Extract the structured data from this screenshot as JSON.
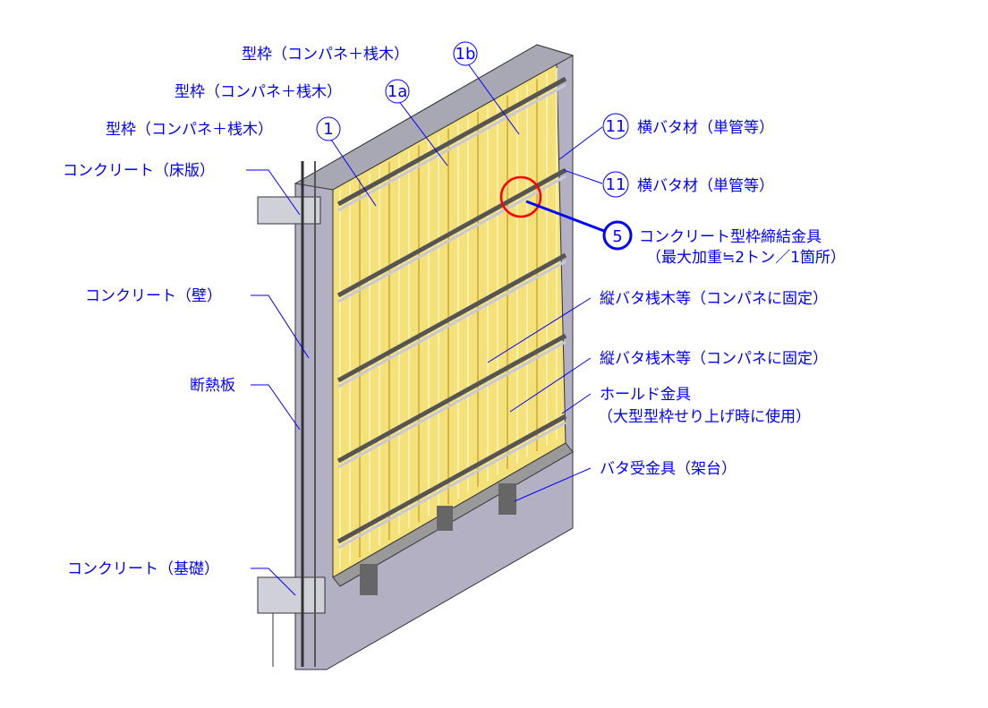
{
  "labels": {
    "formwork_1b": "型枠（コンパネ＋桟木）",
    "formwork_1a": "型枠（コンパネ＋桟木）",
    "formwork_1": "型枠（コンパネ＋桟木）",
    "concrete_slab": "コンクリート（床版）",
    "concrete_wall": "コンクリート（壁）",
    "insulation": "断熱板",
    "concrete_foundation": "コンクリート（基礎）",
    "horizontal_batten_1": "横バタ材（単管等）",
    "horizontal_batten_2": "横バタ材（単管等）",
    "tie_line1": "コンクリート型枠締結金具",
    "tie_line2": "（最大加重≒2トン／1箇所）",
    "vertical_batten_1": "縦バタ桟木等（コンパネに固定）",
    "vertical_batten_2": "縦バタ桟木等（コンパネに固定）",
    "hold_line1": "ホールド金具",
    "hold_line2": "（大型型枠せり上げ時に使用）",
    "batten_bracket": "バタ受金具（架台）"
  },
  "numbers": {
    "n1b": "1b",
    "n1a": "1a",
    "n1": "1",
    "n11a": "11",
    "n11b": "11",
    "n5": "5"
  },
  "colors": {
    "label": "#0000ff",
    "panel": "#f5e17a",
    "wall": "#b4b0c4",
    "highlight_circle": "#ff0000"
  }
}
